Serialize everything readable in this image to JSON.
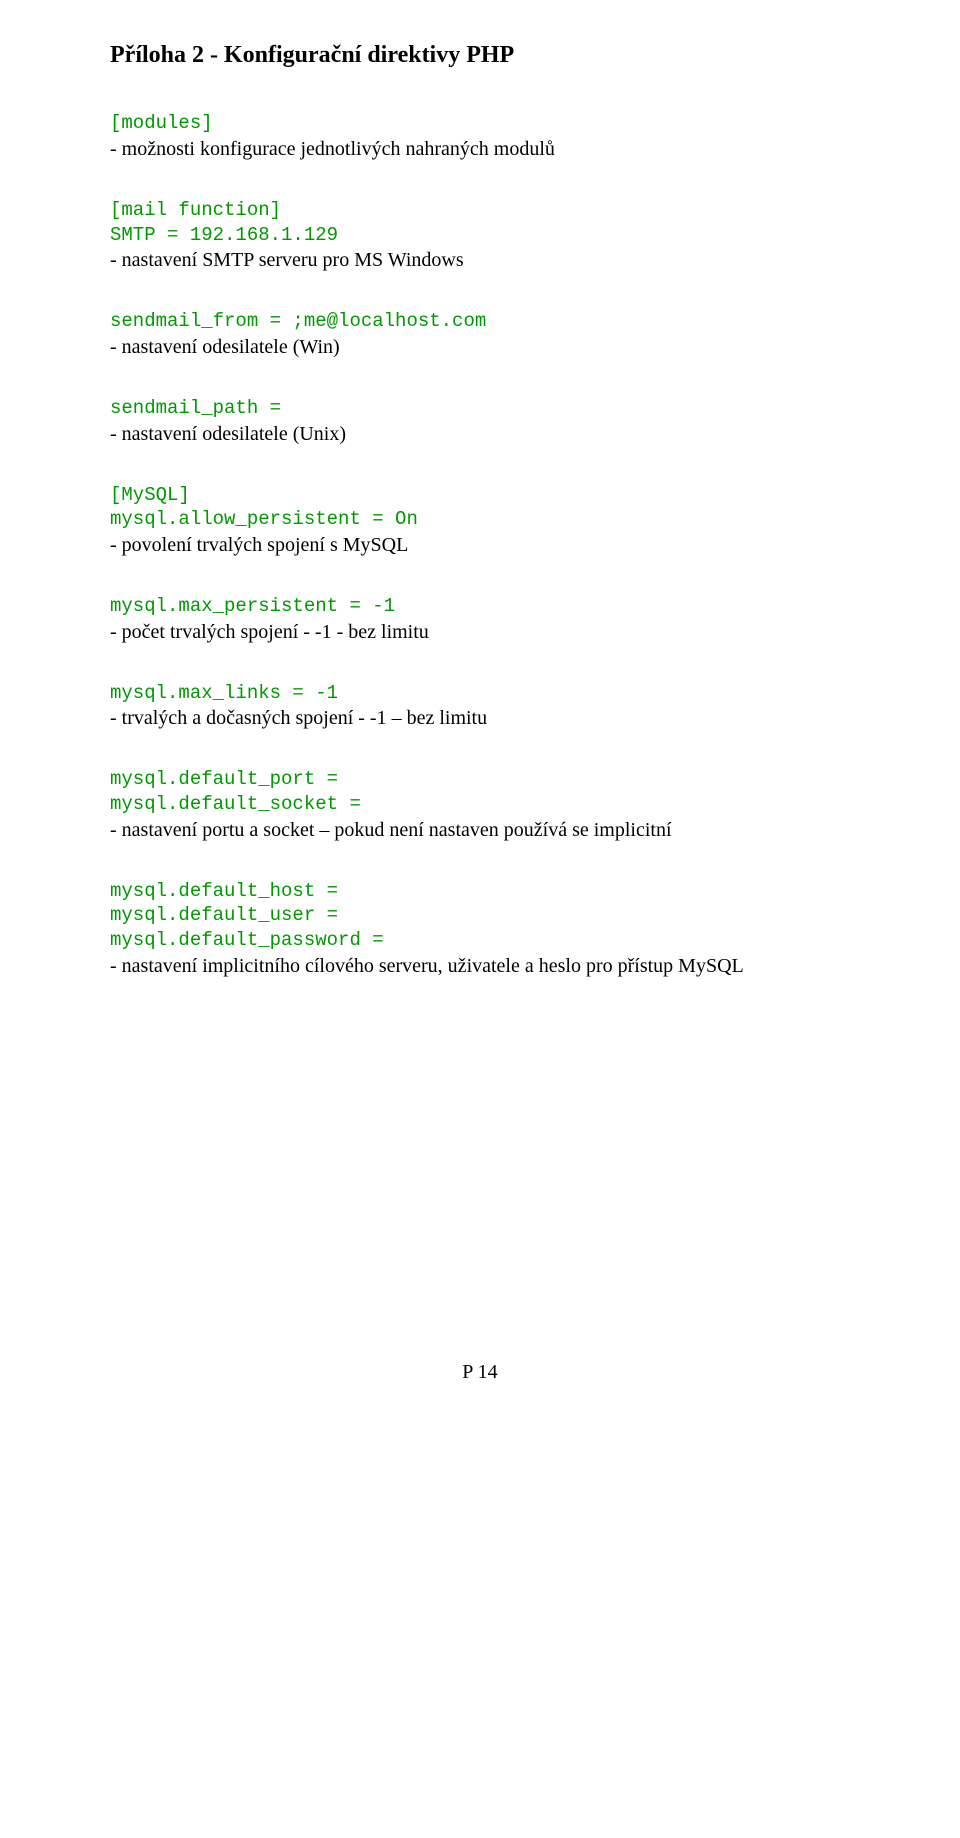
{
  "title": "Příloha 2 - Konfigurační direktivy PHP",
  "blocks": {
    "modules": {
      "code": "[modules]",
      "desc": "- možnosti konfigurace jednotlivých nahraných modulů"
    },
    "mail_function": {
      "code1": "[mail function]",
      "code2": "SMTP = 192.168.1.129",
      "desc": "- nastavení SMTP serveru pro MS Windows"
    },
    "sendmail_from": {
      "code": "sendmail_from = ;me@localhost.com",
      "desc": "- nastavení odesilatele (Win)"
    },
    "sendmail_path": {
      "code": "sendmail_path =",
      "desc": "- nastavení odesilatele (Unix)"
    },
    "mysql_section": {
      "code1": "[MySQL]",
      "code2": "mysql.allow_persistent = On",
      "desc": "- povolení trvalých spojení s MySQL"
    },
    "max_persistent": {
      "code": "mysql.max_persistent = -1",
      "desc": "- počet trvalých spojení - -1 - bez limitu"
    },
    "max_links": {
      "code": "mysql.max_links = -1",
      "desc": "- trvalých a dočasných spojení - -1 – bez limitu"
    },
    "default_port": {
      "code1": "mysql.default_port =",
      "code2": "mysql.default_socket =",
      "desc": "- nastavení portu a socket – pokud není nastaven používá se implicitní"
    },
    "default_host": {
      "code1": "mysql.default_host =",
      "code2": "mysql.default_user =",
      "code3": "mysql.default_password =",
      "desc": "- nastavení implicitního cílového serveru, uživatele a heslo pro přístup MySQL"
    }
  },
  "footer": "P 14"
}
